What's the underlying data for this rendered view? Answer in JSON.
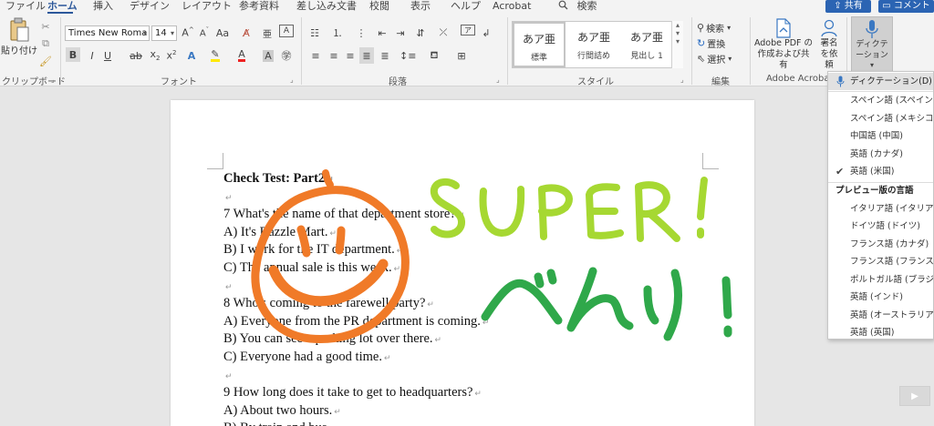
{
  "tabs": [
    "ファイル",
    "ホーム",
    "挿入",
    "デザイン",
    "レイアウト",
    "参考資料",
    "差し込み文書",
    "校閲",
    "表示",
    "ヘルプ",
    "Acrobat"
  ],
  "search_label": "検索",
  "share_label": "共有",
  "comment_label": "コメント",
  "ribbon": {
    "clipboard": {
      "paste_label": "貼り付け",
      "group": "クリップボード"
    },
    "font": {
      "font_name": "Times New Roma",
      "font_size": "14",
      "group": "フォント"
    },
    "paragraph": {
      "group": "段落"
    },
    "styles": {
      "group": "スタイル",
      "items": [
        {
          "sample": "あア亜",
          "name": "標準"
        },
        {
          "sample": "あア亜",
          "name": "行間詰め"
        },
        {
          "sample": "あア亜",
          "name": "見出し 1"
        }
      ]
    },
    "editing": {
      "find": "検索",
      "replace": "置換",
      "select": "選択",
      "group": "編集"
    },
    "acrobat": {
      "create_share": "Adobe PDF の作成および共有",
      "sign": "署名を依頼",
      "group": "Adobe Acrobat"
    },
    "dictate": {
      "label": "ディクテーション"
    }
  },
  "document": {
    "lines": [
      "Check Test: Part2",
      "",
      "7 What's the name of that department store?",
      "A) It's Razzle Mart.",
      "B) I work for the IT department.",
      "C) The annual sale is this week.",
      "",
      "8 Who's coming to the farewell party?",
      "A) Everyone from the PR department is coming.",
      "B) You can see a parking lot over there.",
      "C) Everyone had a good time.",
      "",
      "9 How long does it take to get to headquarters?",
      "A) About two hours.",
      "B) By train and bus."
    ]
  },
  "dictation_menu": {
    "dictation_item": "ディクテーション(D)",
    "languages": [
      "スペイン語 (スペイン)",
      "スペイン語 (メキシコ)",
      "中国語 (中国)",
      "英語 (カナダ)",
      "英語 (米国)"
    ],
    "selected": "英語 (米国)",
    "preview_header": "プレビュー版の言語",
    "preview_languages": [
      "イタリア語 (イタリア)",
      "ドイツ語 (ドイツ)",
      "フランス語 (カナダ)",
      "フランス語 (フランス)",
      "ポルトガル語 (ブラジル)",
      "英語 (インド)",
      "英語 (オーストラリア)",
      "英語 (英国)"
    ]
  },
  "colors": {
    "accent": "#2b579a",
    "ink_orange": "#f07a28",
    "ink_lime": "#a6d832",
    "ink_green": "#2fa84a"
  }
}
